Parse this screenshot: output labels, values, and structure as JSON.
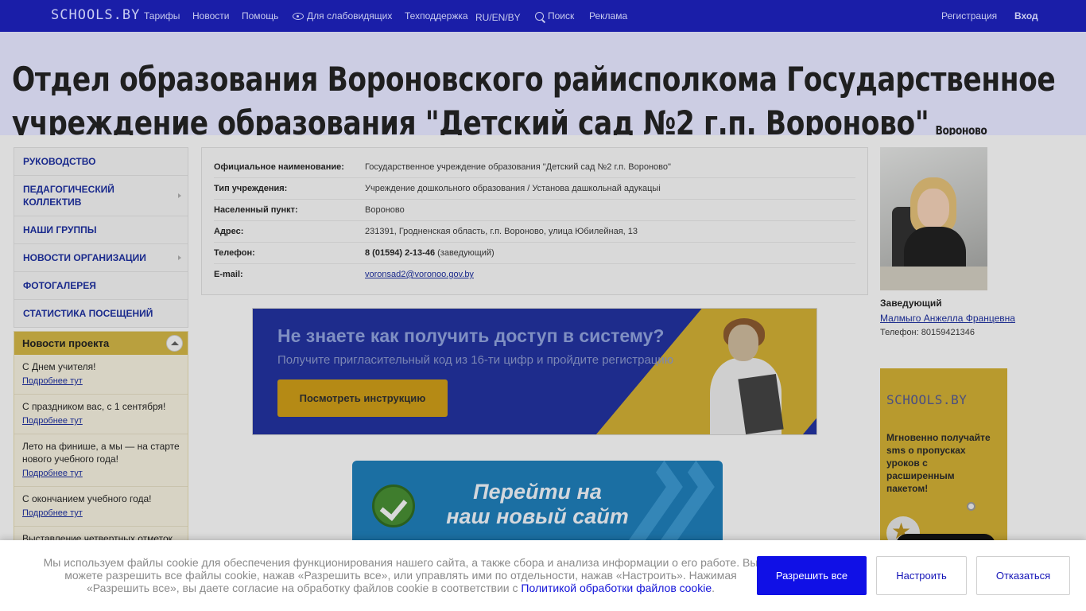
{
  "topnav": {
    "logo": "SCHOOLS.BY",
    "items": [
      "Тарифы",
      "Новости",
      "Помощь",
      "Для слабовидящих",
      "Техподдержка",
      "RU/EN/BY",
      "Поиск",
      "Реклама"
    ],
    "register": "Регистрация",
    "login": "Вход"
  },
  "header": {
    "title": "Отдел образования Вороновского райисполкома Государственное учреждение образования \"Детский сад №2 г.п. Вороново\"",
    "place": "Вороново"
  },
  "menu": {
    "items": [
      "Руководство",
      "Педагогический коллектив",
      "Наши группы",
      "Новости организации",
      "Фотогалерея",
      "Статистика посещений"
    ]
  },
  "news": {
    "title": "Новости проекта",
    "more_label": "Подробнее тут",
    "items": [
      "С Днем учителя!",
      "С праздником вас, с 1 сентября!",
      "Лето на финише, а мы — на старте нового учебного года!",
      "С окончанием учебного года!",
      "Выставление четвертных отметок"
    ]
  },
  "info": {
    "rows": [
      {
        "label": "Официальное наименование:",
        "value": "Государственное учреждение образования \"Детский сад №2 г.п. Вороново\""
      },
      {
        "label": "Тип учреждения:",
        "value": "Учреждение дошкольного образования / Установа дашкольнай адукацыі"
      },
      {
        "label": "Населенный пункт:",
        "value": "Вороново"
      },
      {
        "label": "Адрес:",
        "value": "231391, Гродненская область, г.п. Вороново, улица Юбилейная, 13"
      },
      {
        "label": "Телефон:",
        "phone": "8 (01594) 2-13-46",
        "value": "(заведующий)"
      },
      {
        "label": "E-mail:",
        "value": "voronsad2@voronoo.gov.by"
      }
    ]
  },
  "banner_access": {
    "title": "Не знаете как получить доступ в систему?",
    "subtitle": "Получите пригласительный код из 16-ти цифр и пройдите регистрацию",
    "button": "Посмотреть инструкцию"
  },
  "banner_newsite": {
    "line1": "Перейти на",
    "line2": "наш новый сайт"
  },
  "director": {
    "role": "Заведующий",
    "name": "Малмыго Анжелла Францевна",
    "phone": "Телефон: 80159421346"
  },
  "sms_banner": {
    "logo": "SCHOOLS.BY",
    "text": "Мгновенно получайте sms о пропусках уроков с расширенным пакетом!"
  },
  "cookie": {
    "text": "Мы используем файлы cookie для обеспечения функционирования нашего сайта, а также сбора и анализа информации о его работе. Вы можете разрешить все файлы cookie, нажав «Разрешить все», или управлять ими по отдельности, нажав «Настроить». Нажимая «Разрешить все», вы даете согласие на обработку файлов cookie в соответствии с",
    "link": "Политикой обработки файлов cookie",
    "allow": "Разрешить все",
    "setup": "Настроить",
    "refuse": "Отказаться"
  },
  "colors": {
    "topbar": "#1a1ea8",
    "link": "#1a2a8c",
    "accent_gold": "#b89a2e",
    "allow_button": "#1010e6"
  }
}
